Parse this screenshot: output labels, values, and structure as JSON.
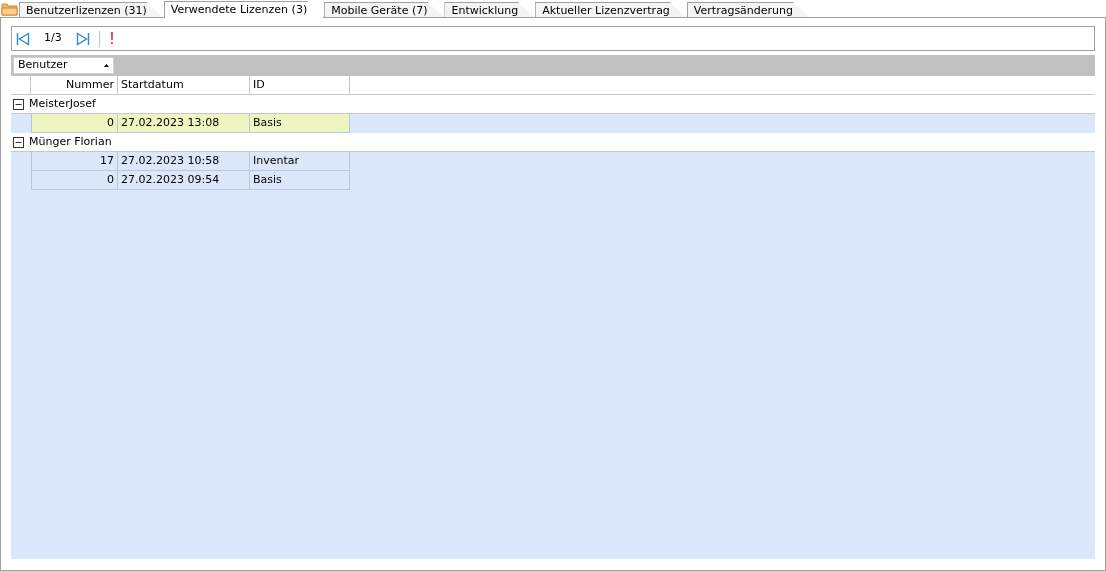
{
  "tabs": [
    {
      "label": "Benutzerlizenzen (31)",
      "selected": false
    },
    {
      "label": "Verwendete Lizenzen (3)",
      "selected": true
    },
    {
      "label": "Mobile Geräte (7)",
      "selected": false
    },
    {
      "label": "Entwicklung",
      "selected": false
    },
    {
      "label": "Aktueller Lizenzvertrag",
      "selected": false
    },
    {
      "label": "Vertragsänderung",
      "selected": false
    }
  ],
  "toolbar": {
    "page": "1/3",
    "alert": "!"
  },
  "group_by": {
    "label": "Benutzer",
    "sorted_ascending": true
  },
  "table": {
    "columns": [
      "Nummer",
      "Startdatum",
      "ID"
    ],
    "groups": [
      {
        "name": "MeisterJosef",
        "expanded": true,
        "rows": [
          {
            "cells": [
              "0",
              "27.02.2023 13:08",
              "Basis"
            ],
            "selected": true
          }
        ]
      },
      {
        "name": "Münger Florian",
        "expanded": true,
        "rows": [
          {
            "cells": [
              "17",
              "27.02.2023 10:58",
              "Inventar"
            ],
            "selected": false
          },
          {
            "cells": [
              "0",
              "27.02.2023 09:54",
              "Basis"
            ],
            "selected": false
          }
        ]
      }
    ]
  }
}
